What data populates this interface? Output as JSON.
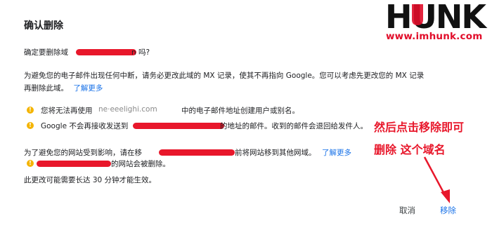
{
  "dialog": {
    "title": "确认删除",
    "confirm_prefix": "确定要删除域",
    "confirm_suffix": "n 吗?",
    "para1_line1": "为避免您的电子邮件出现任何中断，请务必更改此域的 MX 记录，使其不再指向 Google。您可以考虑先更改您的 MX 记录",
    "para1_line2": "再删除此域。",
    "learn_more_1": "了解更多",
    "warning1_prefix": "您将无法再使用",
    "warning1_suffix": "中的电子邮件地址创建用户或别名。",
    "warning2_prefix": "Google 不会再接收发送到",
    "warning2_suffix": "的地址的邮件。收到的邮件会退回给发件人。",
    "para2_prefix": "为了避免您的网站受到影响，请在移",
    "para2_suffix": "前将网站移到其他网域。",
    "learn_more_2": "了解更多",
    "warning3_suffix": "的网站会被删除。",
    "para3": "此更改可能需要长达 30 分钟才能生效。",
    "cancel_label": "取消",
    "remove_label": "移除"
  },
  "annotation": {
    "line1": "然后点击移除即可",
    "line2": "删除 这个域名"
  },
  "watermark": {
    "logo_text": "HUNK",
    "url": "www.imhunk.com"
  },
  "colors": {
    "link": "#1a73e8",
    "warning": "#f4b400",
    "annotation": "#e8172b",
    "redaction": "#e8172b"
  },
  "icons": {
    "warning": "exclamation-circle",
    "pointer": "red-arrow"
  }
}
